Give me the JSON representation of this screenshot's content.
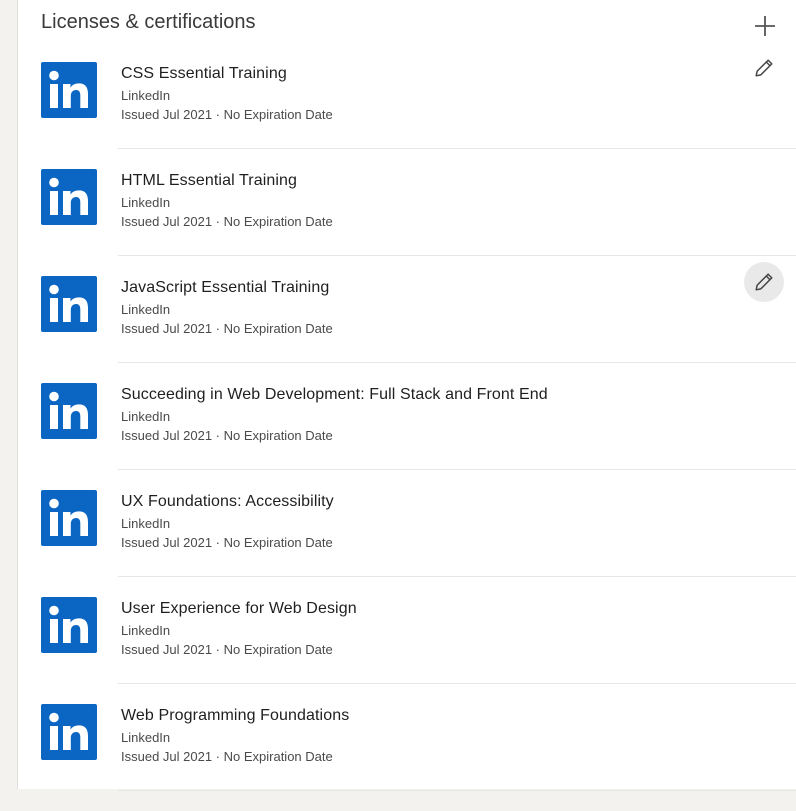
{
  "section": {
    "title": "Licenses & certifications",
    "add_icon": "plus-icon",
    "edit_icon": "pencil-icon"
  },
  "colors": {
    "brand": "#0a66c2",
    "divider": "#e6e6e6",
    "hover": "#e9e9e9"
  },
  "certifications": [
    {
      "title": "CSS Essential Training",
      "org": "LinkedIn",
      "issued": "Issued Jul 2021 · No Expiration Date",
      "edit_visible": true,
      "edit_hover": false
    },
    {
      "title": "HTML Essential Training",
      "org": "LinkedIn",
      "issued": "Issued Jul 2021 · No Expiration Date",
      "edit_visible": false,
      "edit_hover": false
    },
    {
      "title": "JavaScript Essential Training",
      "org": "LinkedIn",
      "issued": "Issued Jul 2021 · No Expiration Date",
      "edit_visible": true,
      "edit_hover": true
    },
    {
      "title": "Succeeding in Web Development: Full Stack and Front End",
      "org": "LinkedIn",
      "issued": "Issued Jul 2021 · No Expiration Date",
      "edit_visible": false,
      "edit_hover": false
    },
    {
      "title": "UX Foundations: Accessibility",
      "org": "LinkedIn",
      "issued": "Issued Jul 2021 · No Expiration Date",
      "edit_visible": false,
      "edit_hover": false
    },
    {
      "title": "User Experience for Web Design",
      "org": "LinkedIn",
      "issued": "Issued Jul 2021 · No Expiration Date",
      "edit_visible": false,
      "edit_hover": false
    },
    {
      "title": "Web Programming Foundations",
      "org": "LinkedIn",
      "issued": "Issued Jul 2021 · No Expiration Date",
      "edit_visible": false,
      "edit_hover": false
    }
  ]
}
